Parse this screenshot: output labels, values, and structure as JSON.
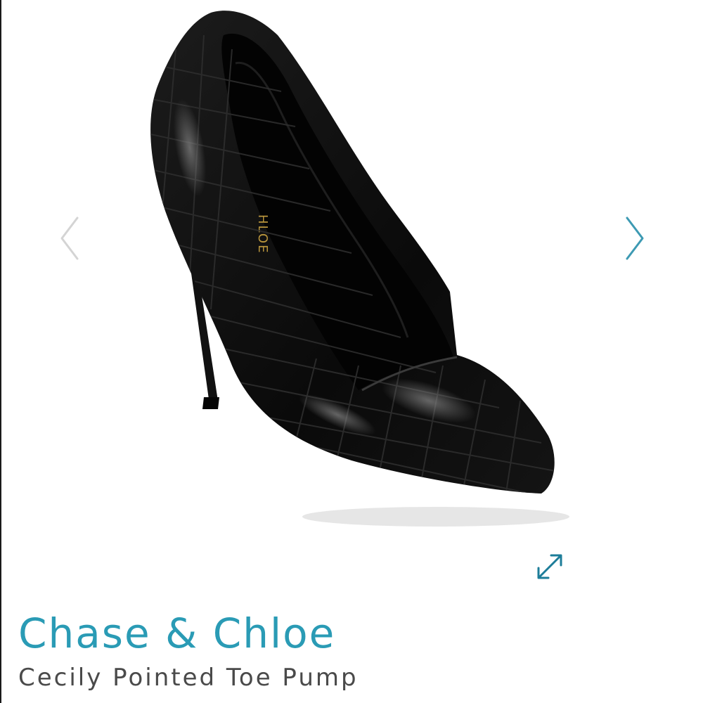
{
  "product": {
    "brand": "Chase & Chloe",
    "name": "Cecily Pointed Toe Pump",
    "insole_print": "HLOE"
  },
  "gallery": {
    "prev_icon": "chevron-left-icon",
    "next_icon": "chevron-right-icon",
    "expand_icon": "expand-arrows-icon"
  },
  "colors": {
    "brand": "#2a9bb5",
    "product_name": "#4a4a4a",
    "nav_inactive": "#d4d4d4",
    "nav_active": "#3d9ab3",
    "expand": "#1d7d99",
    "shoe": "#0c0c0c"
  }
}
